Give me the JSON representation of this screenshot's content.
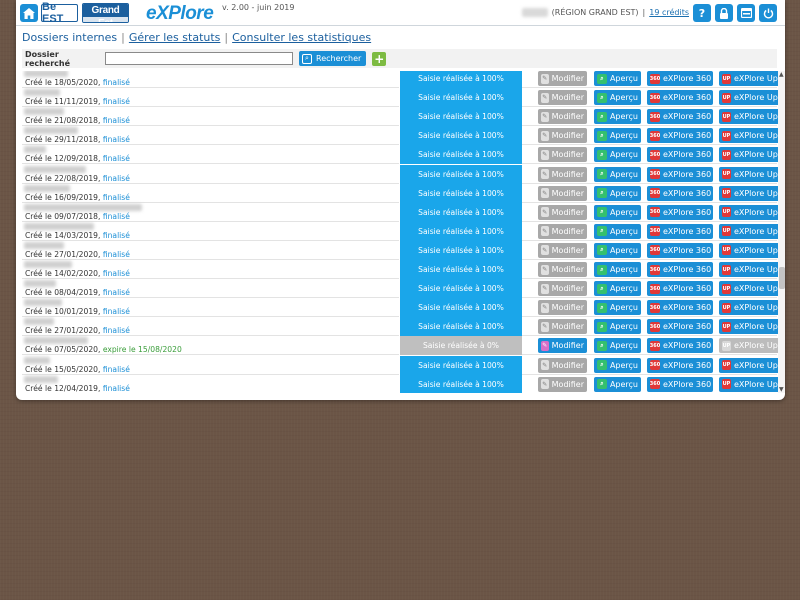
{
  "header": {
    "logo_be": "Be EST",
    "logo_grandest": "Grand Est",
    "logo_explore": "eXPlore",
    "version": "v. 2.00 - juin 2019",
    "region": "(RÉGION GRAND EST)",
    "credits": "19 crédits",
    "icons": [
      "help-icon",
      "lock-icon",
      "window-icon",
      "power-icon"
    ]
  },
  "nav": {
    "dossiers_internes": "Dossiers internes",
    "gerer_statuts": "Gérer les statuts",
    "consulter_stats": "Consulter les statistiques"
  },
  "search": {
    "label": "Dossier recherché",
    "value": "",
    "button": "Rechercher",
    "add": "+"
  },
  "labels": {
    "modifier": "Modifier",
    "apercu": "Aperçu",
    "explore360": "eXPlore 360",
    "exploreup": "eXPlore Up'"
  },
  "rows": [
    {
      "date": "Créé le 18/05/2020,",
      "status": "finalisé",
      "saisie": "Saisie réalisée à 100%"
    },
    {
      "date": "Créé le 11/11/2019,",
      "status": "finalisé",
      "saisie": "Saisie réalisée à 100%"
    },
    {
      "date": "Créé le 21/08/2018,",
      "status": "finalisé",
      "saisie": "Saisie réalisée à 100%"
    },
    {
      "date": "Créé le 29/11/2018,",
      "status": "finalisé",
      "saisie": "Saisie réalisée à 100%"
    },
    {
      "date": "Créé le 12/09/2018,",
      "status": "finalisé",
      "saisie": "Saisie réalisée à 100%"
    },
    {
      "date": "Créé le 22/08/2019,",
      "status": "finalisé",
      "saisie": "Saisie réalisée à 100%"
    },
    {
      "date": "Créé le 16/09/2019,",
      "status": "finalisé",
      "saisie": "Saisie réalisée à 100%"
    },
    {
      "date": "Créé le 09/07/2018,",
      "status": "finalisé",
      "saisie": "Saisie réalisée à 100%"
    },
    {
      "date": "Créé le 14/03/2019,",
      "status": "finalisé",
      "saisie": "Saisie réalisée à 100%"
    },
    {
      "date": "Créé le 27/01/2020,",
      "status": "finalisé",
      "saisie": "Saisie réalisée à 100%"
    },
    {
      "date": "Créé le 14/02/2020,",
      "status": "finalisé",
      "saisie": "Saisie réalisée à 100%"
    },
    {
      "date": "Créé le 08/04/2019,",
      "status": "finalisé",
      "saisie": "Saisie réalisée à 100%"
    },
    {
      "date": "Créé le 10/01/2019,",
      "status": "finalisé",
      "saisie": "Saisie réalisée à 100%"
    },
    {
      "date": "Créé le 27/01/2020,",
      "status": "finalisé",
      "saisie": "Saisie réalisée à 100%"
    },
    {
      "date": "Créé le 07/05/2020,",
      "status": "expire le 15/08/2020",
      "saisie": "Saisie réalisée à 0%"
    },
    {
      "date": "Créé le 15/05/2020,",
      "status": "finalisé",
      "saisie": "Saisie réalisée à 100%"
    },
    {
      "date": "Créé le 12/04/2019,",
      "status": "finalisé",
      "saisie": "Saisie réalisée à 100%"
    }
  ],
  "colors": {
    "accent": "#1b8fd6",
    "saisie_full": "#1aa6ea",
    "saisie_zero": "#bfbfbf",
    "finalise": "#1b8fd6",
    "expire": "#3a9d3a"
  }
}
